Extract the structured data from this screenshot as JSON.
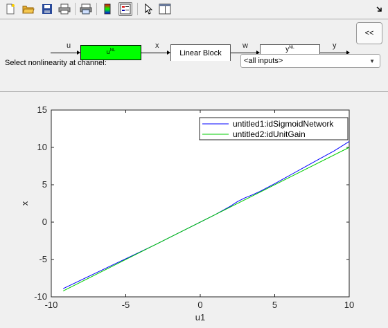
{
  "toolbar": {
    "items": [
      {
        "name": "new-file-icon"
      },
      {
        "name": "open-folder-icon"
      },
      {
        "name": "save-icon"
      },
      {
        "name": "print-icon"
      },
      {
        "name": "print-preview-icon"
      },
      {
        "name": "colorbar-icon"
      },
      {
        "name": "legend-icon",
        "active": true
      },
      {
        "name": "pointer-icon"
      },
      {
        "name": "property-editor-icon"
      }
    ],
    "dock_icon": "undock-arrow-icon"
  },
  "diagram": {
    "signals": {
      "u": "u",
      "x": "x",
      "w": "w",
      "y": "y"
    },
    "input_block": {
      "label": "u",
      "sub": "NL",
      "color": "#00ff00"
    },
    "linear_block": {
      "label": "Linear Block"
    },
    "output_block": {
      "label": "y",
      "sub": "NL"
    },
    "collapse_label": "<<",
    "channel_label": "Select nonlinearity at channel:",
    "channel_value": "<all inputs>"
  },
  "chart_data": {
    "type": "line",
    "xlabel": "u1",
    "ylabel": "x",
    "xlim": [
      -10,
      10
    ],
    "ylim": [
      -10,
      15
    ],
    "xticks": [
      -10,
      -5,
      0,
      5,
      10
    ],
    "yticks": [
      -10,
      -5,
      0,
      5,
      10,
      15
    ],
    "grid": false,
    "legend_position": "top-right",
    "series": [
      {
        "name": "untitled1:idSigmoidNetwork",
        "color": "#0000ff",
        "x": [
          -9.2,
          -7,
          -5,
          -3,
          -1,
          0,
          1,
          2,
          2.5,
          3,
          3.5,
          4,
          5,
          6,
          7,
          8,
          9,
          10
        ],
        "y": [
          -8.9,
          -6.8,
          -4.9,
          -3.0,
          -1.0,
          0.0,
          1.0,
          2.1,
          2.75,
          3.25,
          3.65,
          4.1,
          5.15,
          6.25,
          7.35,
          8.45,
          9.55,
          10.8
        ]
      },
      {
        "name": "untitled2:idUnitGain",
        "color": "#00cc00",
        "x": [
          -9.2,
          10
        ],
        "y": [
          -9.2,
          10
        ]
      }
    ]
  }
}
